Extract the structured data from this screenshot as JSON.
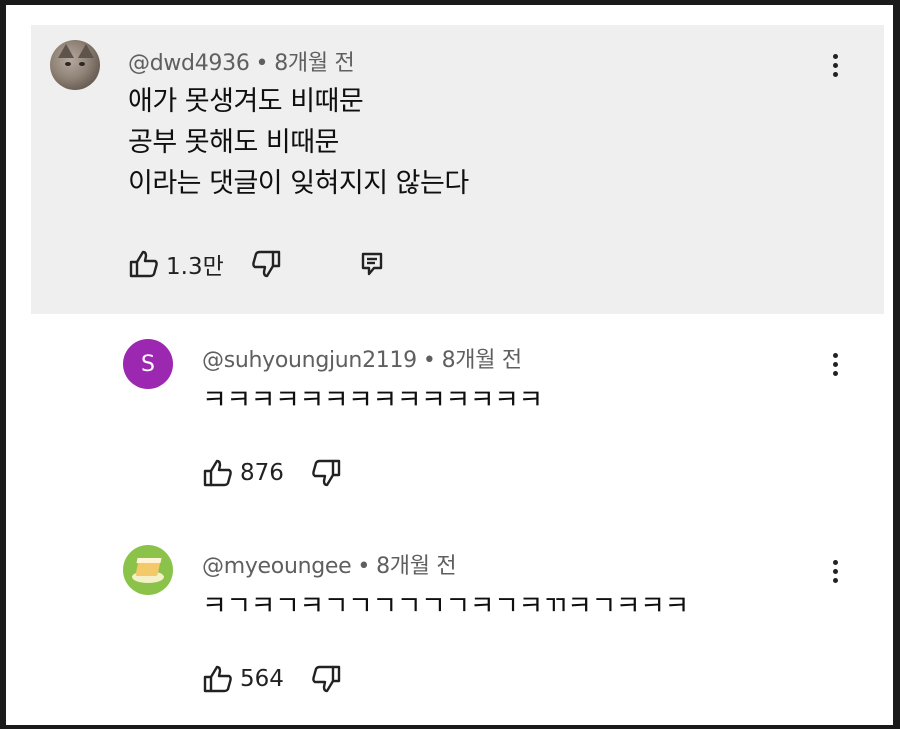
{
  "comments": [
    {
      "author": "@dwd4936",
      "age": "8개월 전",
      "lines": [
        "애가 못생겨도 비때문",
        "공부 못해도 비때문",
        "이라는 댓글이 잊혀지지 않는다"
      ],
      "likes": "1.3만",
      "avatar_icon": "cat-photo"
    },
    {
      "author": "@suhyoungjun2119",
      "age": "8개월 전",
      "text": "ㅋㅋㅋㅋㅋㅋㅋㅋㅋㅋㅋㅋㅋㅋ",
      "likes": "876",
      "avatar_letter": "S",
      "avatar_color": "#9c27b0"
    },
    {
      "author": "@myeoungee",
      "age": "8개월 전",
      "text": "ㅋㄱㅋㄱㅋㄱㄱㄱㄱㄱㄱㅋㄱㅋㄲㅋㄱㅋㅋㅋ",
      "likes": "564",
      "avatar_icon": "cake-slice"
    }
  ],
  "ui": {
    "separator": "•"
  }
}
